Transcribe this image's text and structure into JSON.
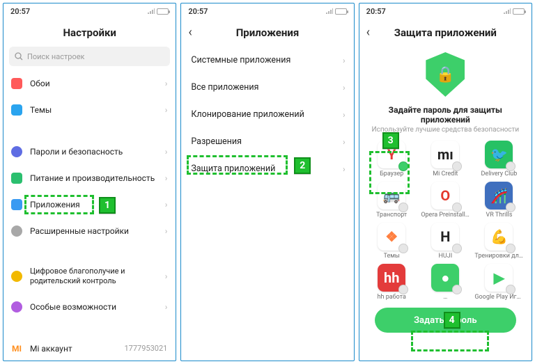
{
  "status": {
    "time": "20:57"
  },
  "callouts": {
    "1": "1",
    "2": "2",
    "3": "3",
    "4": "4"
  },
  "screen1": {
    "title": "Настройки",
    "search_placeholder": "Поиск настроек",
    "rows": [
      {
        "label": "Обои"
      },
      {
        "label": "Темы"
      },
      {
        "label": "Пароли и безопасность"
      },
      {
        "label": "Питание и производительность"
      },
      {
        "label": "Приложения"
      },
      {
        "label": "Расширенные настройки"
      },
      {
        "label": "Цифровое благополучие и родительский контроль"
      },
      {
        "label": "Особые возможности"
      },
      {
        "label": "Mi аккаунт",
        "value": "1777953021"
      }
    ]
  },
  "screen2": {
    "title": "Приложения",
    "rows": [
      {
        "label": "Системные приложения"
      },
      {
        "label": "Все приложения"
      },
      {
        "label": "Клонирование приложений"
      },
      {
        "label": "Разрешения"
      },
      {
        "label": "Защита приложений"
      }
    ]
  },
  "screen3": {
    "title": "Защита приложений",
    "subtitle": "Задайте пароль для защиты приложений",
    "subtext": "Используйте лучшие средства безопасности",
    "apps": [
      {
        "label": "Браузер",
        "bg": "#fff",
        "fg": "#e63737",
        "glyph": "Y",
        "selected": true
      },
      {
        "label": "Mi Credit",
        "bg": "#fff",
        "fg": "#222",
        "glyph": "mı"
      },
      {
        "label": "Delivery Club",
        "bg": "#27c164",
        "fg": "#111",
        "glyph": "🐦"
      },
      {
        "label": "Транспорт",
        "bg": "#fff",
        "fg": "#4aa3e6",
        "glyph": "🚌"
      },
      {
        "label": "Opera Preinstall Data",
        "bg": "#fff",
        "fg": "#e4382c",
        "glyph": "O"
      },
      {
        "label": "VR Thrills",
        "bg": "#3f6fbe",
        "fg": "#fff",
        "glyph": "🎢"
      },
      {
        "label": "Темы",
        "bg": "#fff",
        "fg": "#ff7f3f",
        "glyph": "❖"
      },
      {
        "label": "HUJI",
        "bg": "#fff",
        "fg": "#222",
        "glyph": "H"
      },
      {
        "label": "Тренировки для До…",
        "bg": "#fff",
        "fg": "#c33b3b",
        "glyph": "💪"
      },
      {
        "label": "hh работа",
        "bg": "#e33b3b",
        "fg": "#fff",
        "glyph": "hh"
      },
      {
        "label": "…",
        "bg": "#3dcf6a",
        "fg": "#fff",
        "glyph": "●"
      },
      {
        "label": "Google Play Игры",
        "bg": "#fff",
        "fg": "#3dcf6a",
        "glyph": "▶"
      }
    ],
    "set_password": "Задать пароль"
  }
}
